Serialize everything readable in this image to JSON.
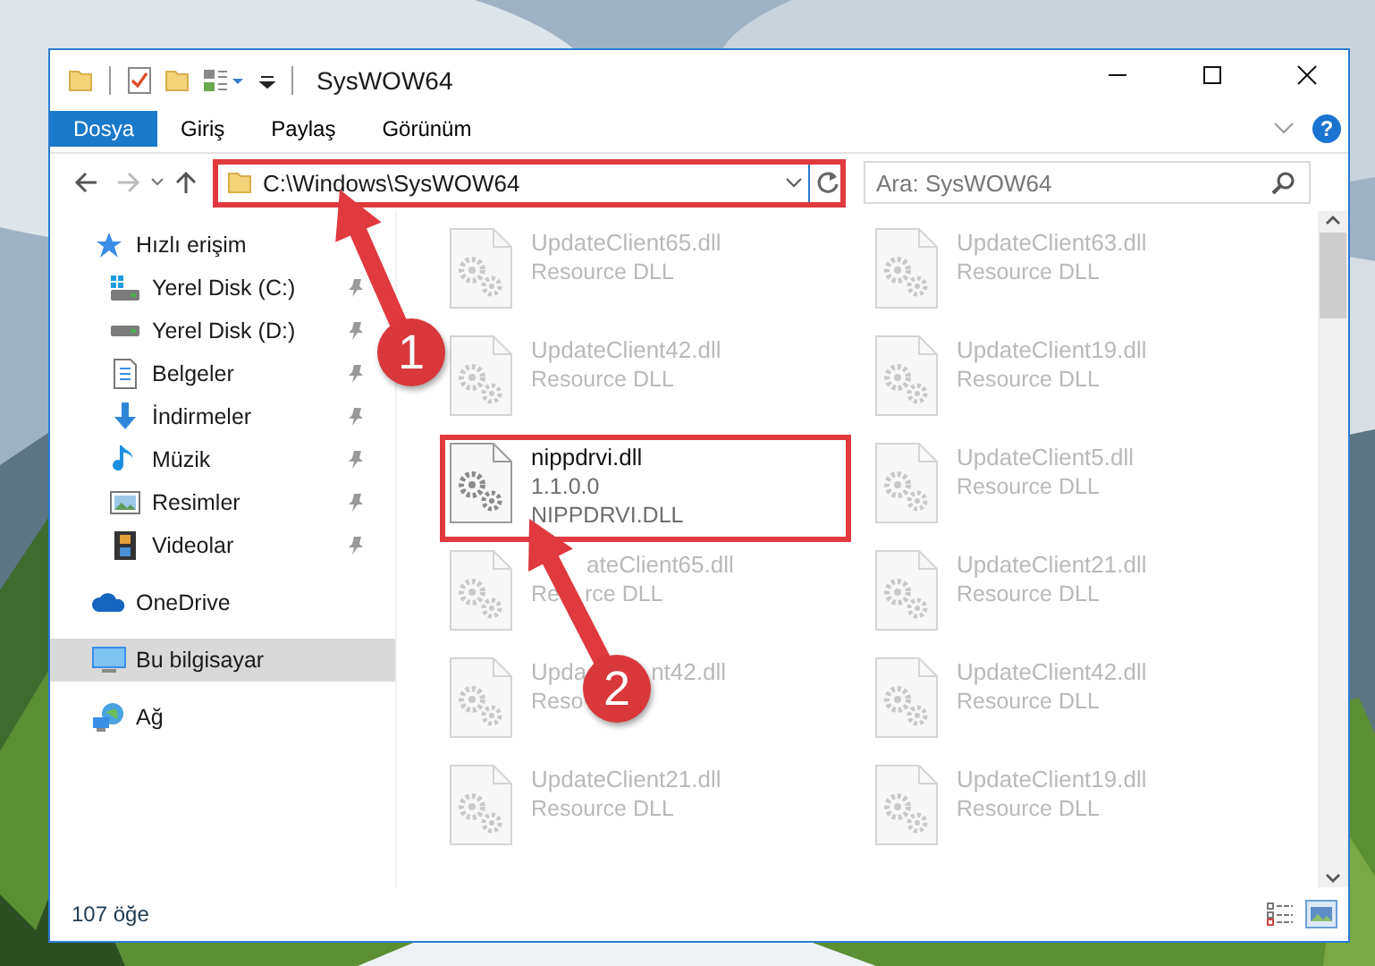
{
  "window": {
    "title": "SysWOW64",
    "help": "?"
  },
  "ribbon_tabs": [
    {
      "label": "Dosya",
      "selected": true
    },
    {
      "label": "Giriş",
      "selected": false
    },
    {
      "label": "Paylaş",
      "selected": false
    },
    {
      "label": "Görünüm",
      "selected": false
    }
  ],
  "address": {
    "value": "C:\\Windows\\SysWOW64",
    "highlighted": true
  },
  "search": {
    "placeholder": "Ara: SysWOW64"
  },
  "sidebar": {
    "items": [
      {
        "label": "Hızlı erişim",
        "kind": "star",
        "selected": false,
        "children": [
          {
            "label": "Yerel Disk (C:)",
            "kind": "system-drive",
            "pinned": true,
            "selected": false
          },
          {
            "label": "Yerel Disk (D:)",
            "kind": "drive",
            "pinned": true,
            "selected": false
          },
          {
            "label": "Belgeler",
            "kind": "document",
            "pinned": true,
            "selected": false
          },
          {
            "label": "İndirmeler",
            "kind": "download",
            "pinned": true,
            "selected": false
          },
          {
            "label": "Müzik",
            "kind": "music",
            "pinned": true,
            "selected": false
          },
          {
            "label": "Resimler",
            "kind": "picture",
            "pinned": true,
            "selected": false
          },
          {
            "label": "Videolar",
            "kind": "film",
            "pinned": true,
            "selected": false
          }
        ]
      },
      {
        "label": "OneDrive",
        "kind": "cloud",
        "selected": false
      },
      {
        "label": "Bu bilgisayar",
        "kind": "computer",
        "selected": true
      },
      {
        "label": "Ağ",
        "kind": "network",
        "selected": false
      }
    ]
  },
  "files": [
    {
      "lines": [
        {
          "parts": [
            "UpdateClient65.dll"
          ]
        },
        {
          "parts": [
            "Resource DLL"
          ]
        }
      ],
      "faded": true,
      "highlighted": false
    },
    {
      "lines": [
        {
          "parts": [
            "UpdateClient63.dll"
          ]
        },
        {
          "parts": [
            "Resource DLL"
          ]
        }
      ],
      "faded": true,
      "highlighted": false
    },
    {
      "lines": [
        {
          "parts": [
            "UpdateClient42.dll"
          ]
        },
        {
          "parts": [
            "Resource DLL"
          ]
        }
      ],
      "faded": true,
      "highlighted": false
    },
    {
      "lines": [
        {
          "parts": [
            "UpdateClient19.dll"
          ]
        },
        {
          "parts": [
            "Resource DLL"
          ]
        }
      ],
      "faded": true,
      "highlighted": false
    },
    {
      "lines": [
        {
          "parts": [
            "nippdrvi.dll"
          ]
        },
        {
          "parts": [
            "1.1.0.0"
          ]
        },
        {
          "parts": [
            "NIPPDRVI.DLL"
          ]
        }
      ],
      "faded": false,
      "highlighted": true
    },
    {
      "lines": [
        {
          "parts": [
            "UpdateClient5.dll"
          ]
        },
        {
          "parts": [
            "Resource DLL"
          ]
        }
      ],
      "faded": true,
      "highlighted": false
    },
    {
      "lines": [
        {
          "parts": [
            "ateClient65.dll"
          ],
          "covered_start": true
        },
        {
          "parts": [
            "Re",
            "rce DLL"
          ]
        }
      ],
      "faded": true,
      "highlighted": false
    },
    {
      "lines": [
        {
          "parts": [
            "UpdateClient21.dll"
          ]
        },
        {
          "parts": [
            "Resource DLL"
          ]
        }
      ],
      "faded": true,
      "highlighted": false
    },
    {
      "lines": [
        {
          "parts": [
            "Upda",
            "nt42.dll"
          ]
        },
        {
          "parts": [
            "Reso"
          ]
        }
      ],
      "faded": true,
      "highlighted": false
    },
    {
      "lines": [
        {
          "parts": [
            "UpdateClient42.dll"
          ]
        },
        {
          "parts": [
            "Resource DLL"
          ]
        }
      ],
      "faded": true,
      "highlighted": false
    },
    {
      "lines": [
        {
          "parts": [
            "UpdateClient21.dll"
          ]
        },
        {
          "parts": [
            "Resource DLL"
          ]
        }
      ],
      "faded": true,
      "highlighted": false
    },
    {
      "lines": [
        {
          "parts": [
            "UpdateClient19.dll"
          ]
        },
        {
          "parts": [
            "Resource DLL"
          ]
        }
      ],
      "faded": true,
      "highlighted": false
    }
  ],
  "status_bar": {
    "count": "107 öğe"
  },
  "annotations": [
    {
      "label": "1"
    },
    {
      "label": "2"
    }
  ]
}
